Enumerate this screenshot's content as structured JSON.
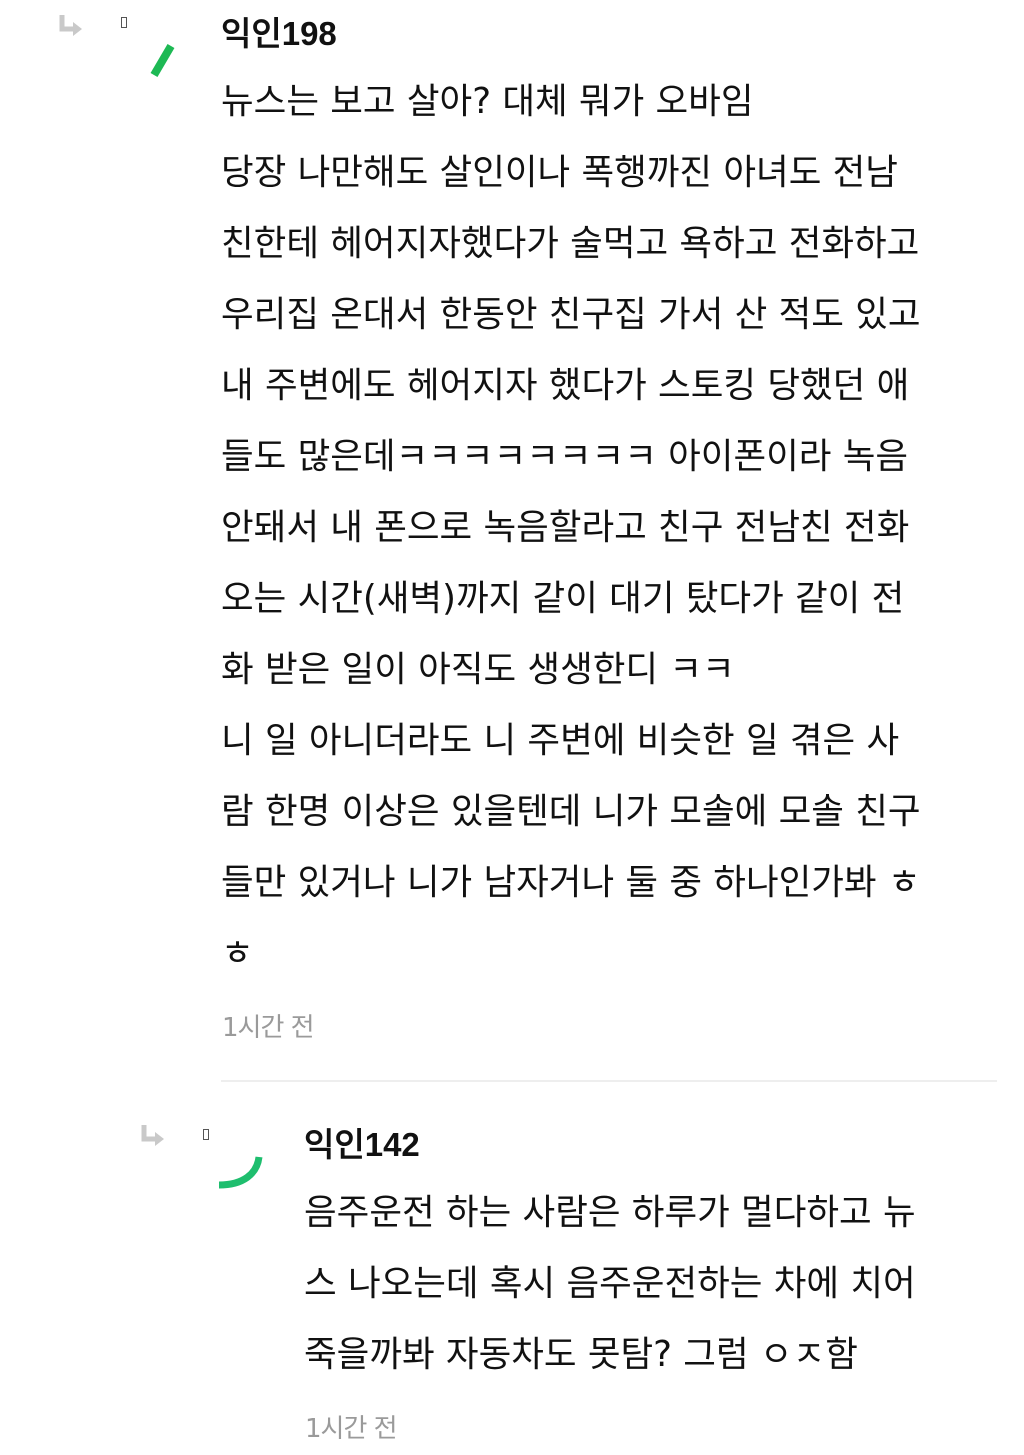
{
  "comments": [
    {
      "author": "익인198",
      "lines": [
        "뉴스는 보고 살아? 대체 뭐가 오바임",
        "당장 나만해도 살인이나 폭행까진 아녀도 전남",
        "친한테 헤어지자했다가 술먹고 욕하고 전화하고",
        "우리집 온대서 한동안 친구집 가서 산 적도 있고",
        "내 주변에도 헤어지자 했다가 스토킹 당했던 애",
        "들도 많은데ㅋㅋㅋㅋㅋㅋㅋㅋ 아이폰이라 녹음",
        "안돼서 내 폰으로 녹음할라고 친구 전남친 전화",
        "오는 시간(새벽)까지 같이 대기 탔다가 같이 전",
        "화 받은 일이 아직도 생생한디 ㅋㅋ",
        "니 일 아니더라도 니 주변에 비슷한 일 겪은 사",
        "람 한명 이상은 있을텐데 니가 모솔에 모솔 친구",
        "들만 있거나 니가 남자거나 둘 중 하나인가봐 ㅎ",
        "ㅎ"
      ],
      "time": "1시간 전",
      "avatar_color": "#1db954"
    },
    {
      "author": "익인142",
      "lines": [
        "음주운전 하는 사람은 하루가 멀다하고 뉴",
        "스 나오는데 혹시 음주운전하는 차에 치어",
        "죽을까봐 자동차도 못탐? 그럼 ㅇㅈ함"
      ],
      "time": "1시간 전",
      "avatar_color": "#1ebe6e"
    }
  ],
  "icons": {
    "reply": "reply-arrow-icon",
    "box": "small-box-icon",
    "avatar": "avatar-mark"
  }
}
